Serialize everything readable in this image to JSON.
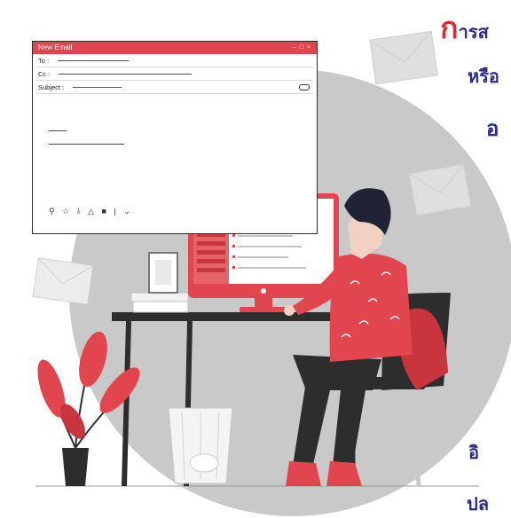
{
  "email_window": {
    "title": "New Email",
    "controls": "– □ ×",
    "to_label": "To :",
    "cc_label": "Cc :",
    "subject_label": "Subject :",
    "toolbar_icons": "⚲ ☆ ⫰ △ ■ | ⌄"
  },
  "side_text": {
    "line1_big": "ก",
    "line1_rest": "ารส",
    "line2": "หรือ",
    "line3": "อ",
    "line4": "อิ",
    "line5": "ปล"
  },
  "colors": {
    "accent_red": "#e1464f",
    "navy_text": "#2b2a8f",
    "dark": "#2d2d2d",
    "circle_gray": "#c9c9c9"
  }
}
